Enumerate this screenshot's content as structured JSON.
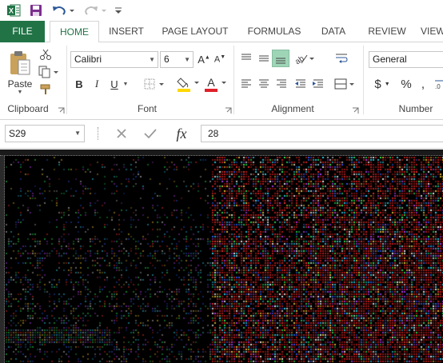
{
  "qat": {
    "excel_icon": "excel-logo-icon",
    "save_icon": "save-icon",
    "undo_icon": "undo-icon",
    "redo_icon": "redo-icon",
    "customize_icon": "customize-qat-icon"
  },
  "tabs": [
    {
      "label": "FILE"
    },
    {
      "label": "HOME"
    },
    {
      "label": "INSERT"
    },
    {
      "label": "PAGE LAYOUT"
    },
    {
      "label": "FORMULAS"
    },
    {
      "label": "DATA"
    },
    {
      "label": "REVIEW"
    },
    {
      "label": "VIEW"
    }
  ],
  "ribbon": {
    "clipboard": {
      "label": "Clipboard",
      "paste_label": "Paste"
    },
    "font": {
      "label": "Font",
      "font_name": "Calibri",
      "font_size": "6",
      "bold": "B",
      "italic": "I",
      "underline": "U"
    },
    "alignment": {
      "label": "Alignment"
    },
    "number": {
      "label": "Number",
      "format": "General",
      "currency": "$",
      "percent": "%"
    }
  },
  "formula_bar": {
    "name_box": "S29",
    "fx_label": "fx",
    "value": "28"
  },
  "colors": {
    "excel_green": "#217346",
    "font_color": "#e0202a",
    "highlight": "#ffd800",
    "sheet_background": "#000000"
  }
}
